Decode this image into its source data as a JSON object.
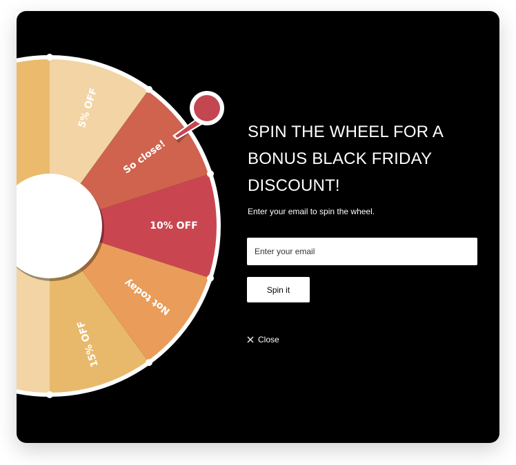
{
  "wheel": {
    "segments": [
      {
        "label": "5% OFF",
        "color": "#F2D4A5"
      },
      {
        "label": "So close!",
        "color": "#CF634E"
      },
      {
        "label": "10% OFF",
        "color": "#C94651"
      },
      {
        "label": "Not today",
        "color": "#EA9C5A"
      },
      {
        "label": "15% OFF",
        "color": "#E9B96B"
      }
    ],
    "colors": {
      "rim": "#FFFFFF",
      "hub": "#FFFFFF",
      "pointer": "#C44651",
      "extra_orange": "#EBBA6C",
      "extra_cream": "#F2D4A5"
    }
  },
  "content": {
    "title": "SPIN THE WHEEL FOR A BONUS BLACK FRIDAY DISCOUNT!",
    "subtitle": "Enter your email to spin the wheel.",
    "email_placeholder": "Enter your email",
    "spin_label": "Spin it",
    "close_label": "Close"
  }
}
